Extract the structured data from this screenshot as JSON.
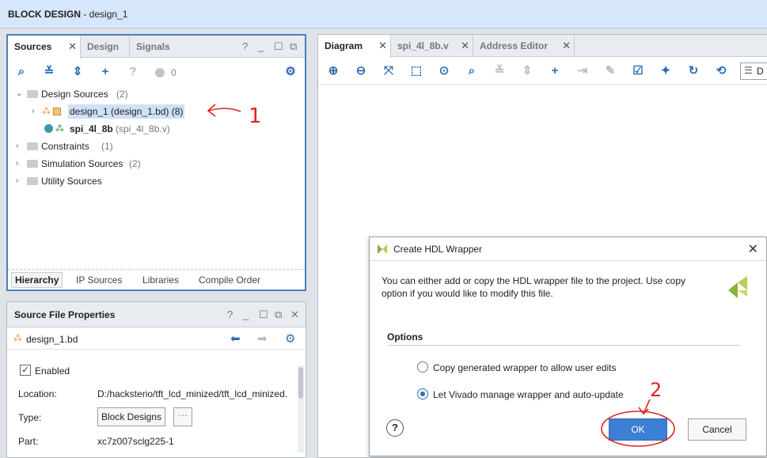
{
  "window": {
    "title_bold": "BLOCK DESIGN",
    "title_rest": " - design_1"
  },
  "sources_panel": {
    "tabs": [
      {
        "label": "Sources"
      },
      {
        "label": "Design"
      },
      {
        "label": "Signals"
      }
    ],
    "toolbar_badge_count": "0",
    "tree": {
      "design_sources": {
        "label": "Design Sources",
        "count": "(2)"
      },
      "design_1": {
        "label": "design_1 (design_1.bd) (8)"
      },
      "spi": {
        "label": "spi_4l_8b",
        "detail": "(spi_4l_8b.v)"
      },
      "constraints": {
        "label": "Constraints",
        "count": "(1)"
      },
      "simulation": {
        "label": "Simulation Sources",
        "count": "(2)"
      },
      "utility": {
        "label": "Utility Sources"
      }
    },
    "bottom_tabs": [
      {
        "label": "Hierarchy"
      },
      {
        "label": "IP Sources"
      },
      {
        "label": "Libraries"
      },
      {
        "label": "Compile Order"
      }
    ]
  },
  "properties_panel": {
    "title": "Source File Properties",
    "file": "design_1.bd",
    "enabled_label": "Enabled",
    "enabled": true,
    "location_label": "Location:",
    "location_value": "D:/hacksterio/tft_lcd_minized/tft_lcd_minized.",
    "type_label": "Type:",
    "type_value": "Block Designs",
    "part_label": "Part:",
    "part_value": "xc7z007sclg225-1"
  },
  "diagram_panel": {
    "tabs": [
      {
        "label": "Diagram"
      },
      {
        "label": "spi_4l_8b.v"
      },
      {
        "label": "Address Editor"
      }
    ],
    "toolbar_trailing": "D"
  },
  "dialog": {
    "title": "Create HDL Wrapper",
    "message": "You can either add or copy the HDL wrapper file to the project. Use copy option if you would like to modify this file.",
    "options_header": "Options",
    "options": [
      {
        "label": "Copy generated wrapper to allow user edits",
        "selected": false
      },
      {
        "label": "Let Vivado manage wrapper and auto-update",
        "selected": true
      }
    ],
    "ok_label": "OK",
    "cancel_label": "Cancel"
  },
  "annotations": {
    "arrow1_label": "1",
    "arrow2_label": "2"
  },
  "colors": {
    "accent": "#3d7fd3",
    "annotation": "#e0221f",
    "selection": "#cfe0f7"
  }
}
